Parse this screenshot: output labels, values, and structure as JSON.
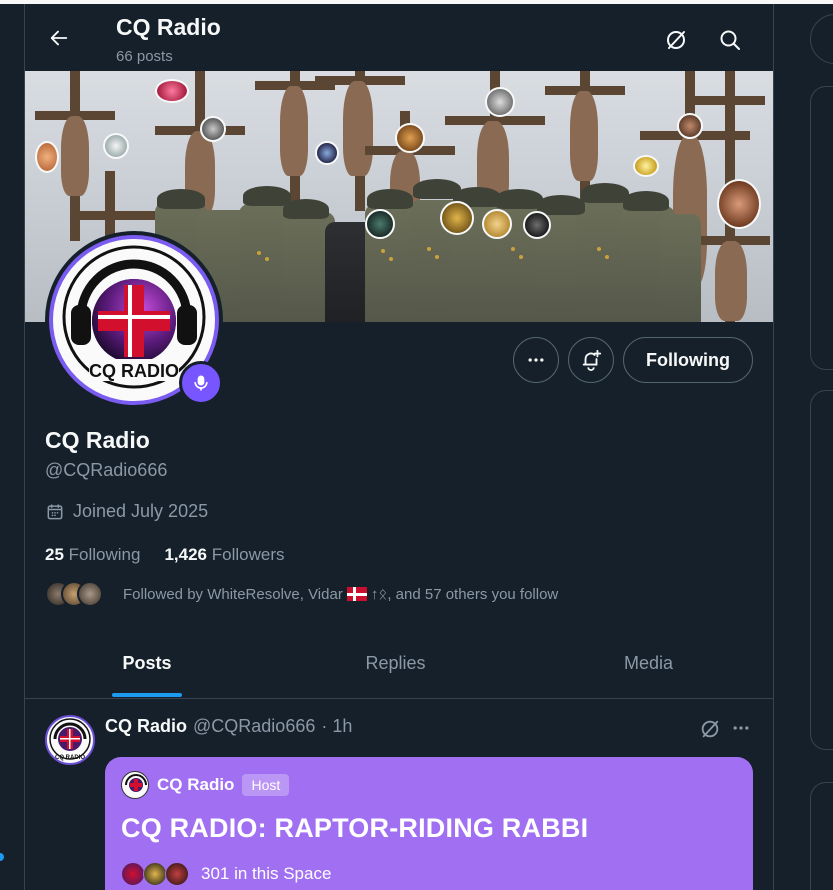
{
  "header": {
    "title": "CQ Radio",
    "subtitle": "66 posts"
  },
  "profile": {
    "display_name": "CQ Radio",
    "handle": "@CQRadio666",
    "joined": "Joined July 2025",
    "following_count": "25",
    "following_label": "Following",
    "followers_count": "1,426",
    "followers_label": "Followers",
    "followed_by_prefix": "Followed by WhiteResolve, Vidar",
    "followed_by_suffix": "↑ᛟ, and 57 others you follow",
    "follow_button": "Following"
  },
  "tabs": [
    {
      "label": "Posts",
      "active": true
    },
    {
      "label": "Replies",
      "active": false
    },
    {
      "label": "Media",
      "active": false
    }
  ],
  "post": {
    "author": "CQ Radio",
    "handle": "@CQRadio666",
    "time": "· 1h",
    "space": {
      "host_name": "CQ Radio",
      "host_badge": "Host",
      "title": "CQ RADIO: RAPTOR-RIDING RABBI",
      "listeners": "301 in this Space"
    }
  },
  "icons": {
    "back": "back-arrow-icon",
    "grok": "grok-icon",
    "search": "search-icon",
    "more": "more-icon",
    "notify": "notification-bell-icon",
    "calendar": "calendar-icon",
    "space": "microphone-icon"
  },
  "colors": {
    "background": "#15202b",
    "accent": "#1d9bf0",
    "space_card": "#a170f2",
    "avatar_ring": "#7856ff",
    "muted_text": "#8b98a5"
  }
}
